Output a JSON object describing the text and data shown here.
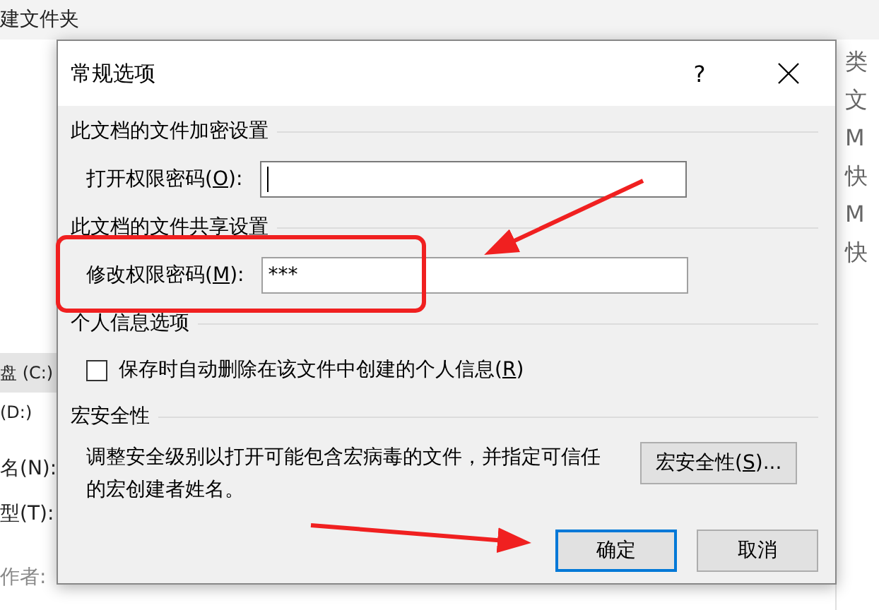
{
  "background_window": {
    "toolbar_button": "建文件夹",
    "right_panel": [
      "类",
      "文",
      "M",
      "快",
      "M",
      "快"
    ],
    "nav_items": [
      {
        "label": "盘 (C:)",
        "selected": true
      },
      {
        "label": "(D:)",
        "selected": false
      }
    ],
    "fields": [
      {
        "label": "名(N):"
      },
      {
        "label": "型(T):"
      }
    ],
    "author_label": "作者:"
  },
  "dialog": {
    "title": "常规选项",
    "help": "?",
    "sections": [
      {
        "title": "此文档的文件加密设置",
        "items": [
          {
            "kind": "password",
            "prefix": "打开权限密码(",
            "key": "O",
            "suffix": "):",
            "focused": true
          }
        ]
      },
      {
        "title": "此文档的文件共享设置",
        "items": [
          {
            "kind": "password",
            "prefix": "修改权限密码(",
            "key": "M",
            "suffix": "):",
            "value": "***",
            "focused": false
          }
        ]
      },
      {
        "title": "个人信息选项",
        "items": [
          {
            "kind": "checkbox",
            "prefix": "保存时自动删除在该文件中创建的个人信息(",
            "key": "R",
            "suffix": ")",
            "checked": false
          }
        ]
      },
      {
        "title": "宏安全性",
        "items": [
          {
            "kind": "macro",
            "text": "调整安全级别以打开可能包含宏病毒的文件，并指定可信任的宏创建者姓名。",
            "prefix": "宏安全性(",
            "key": "S",
            "suffix": ")..."
          }
        ]
      }
    ],
    "buttons": [
      {
        "label": "确定",
        "default": true
      },
      {
        "label": "取消",
        "default": false
      }
    ]
  }
}
